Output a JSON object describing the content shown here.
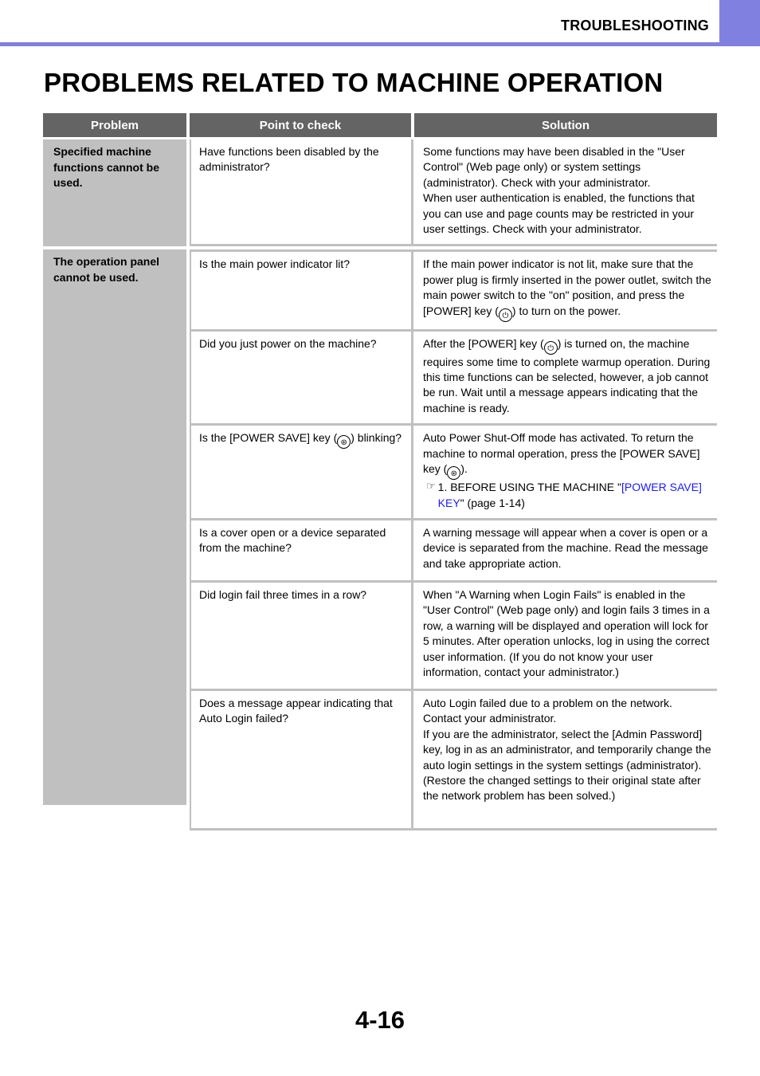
{
  "header": {
    "section": "TROUBLESHOOTING",
    "accent_color": "#8080e0"
  },
  "page_title": "PROBLEMS RELATED TO MACHINE OPERATION",
  "table": {
    "columns": [
      "Problem",
      "Point to check",
      "Solution"
    ],
    "groups": [
      {
        "problem": "Specified machine functions cannot be used.",
        "rows": [
          {
            "check": "Have functions been disabled by the administrator?",
            "solution": "Some functions may have been disabled in the \"User Control\" (Web page only) or system settings (administrator). Check with your administrator.",
            "solution_2": "When user authentication is enabled, the functions that you can use and page counts may be restricted in your user settings. Check with your administrator."
          }
        ]
      },
      {
        "problem": "The operation panel cannot be used.",
        "rows": [
          {
            "check": "Is the main power indicator lit?",
            "solution_pre": "If the main power indicator is not lit, make sure that the power plug is firmly inserted in the power outlet, switch the main power switch to the \"on\" position, and press the [POWER] key (",
            "solution_post": ") to turn on the power."
          },
          {
            "check": "Did you just power on the machine?",
            "solution_pre": "After the [POWER] key (",
            "solution_post": ") is turned on, the machine requires some time to complete warmup operation. During this time functions can be selected, however, a job cannot be run. Wait until a message appears indicating that the machine is ready."
          },
          {
            "check_pre": "Is the [POWER SAVE] key (",
            "check_post": ") blinking?",
            "solution_pre": "Auto Power Shut-Off mode has activated. To return the machine to normal operation, press the [POWER SAVE] key (",
            "solution_post": ").",
            "reference": {
              "prefix": "1. BEFORE USING THE MACHINE \"",
              "link": "[POWER SAVE] KEY",
              "suffix": "\" (page 1-14)"
            }
          },
          {
            "check": "Is a cover open or a device separated from the machine?",
            "solution": "A warning message will appear when a cover is open or a device is separated from the machine. Read the message and take appropriate action."
          },
          {
            "check": "Did login fail three times in a row?",
            "solution": "When \"A Warning when Login Fails\" is enabled in the \"User Control\" (Web page only) and login fails 3 times in a row, a warning will be displayed and operation will lock for 5 minutes. After operation unlocks, log in using the correct user information. (If you do not know your user information, contact your administrator.)"
          },
          {
            "check": "Does a message appear indicating that Auto Login failed?",
            "solution": "Auto Login failed due to a problem on the network. Contact your administrator.",
            "solution_2": "If you are the administrator, select the [Admin Password] key, log in as an administrator, and temporarily change the auto login settings in the system settings (administrator). (Restore the changed settings to their original state after the network problem has been solved.)"
          }
        ]
      }
    ]
  },
  "icons": {
    "power_key": "⏻",
    "power_save_key": "⊛",
    "reference": "☞"
  },
  "page_number": "4-16"
}
